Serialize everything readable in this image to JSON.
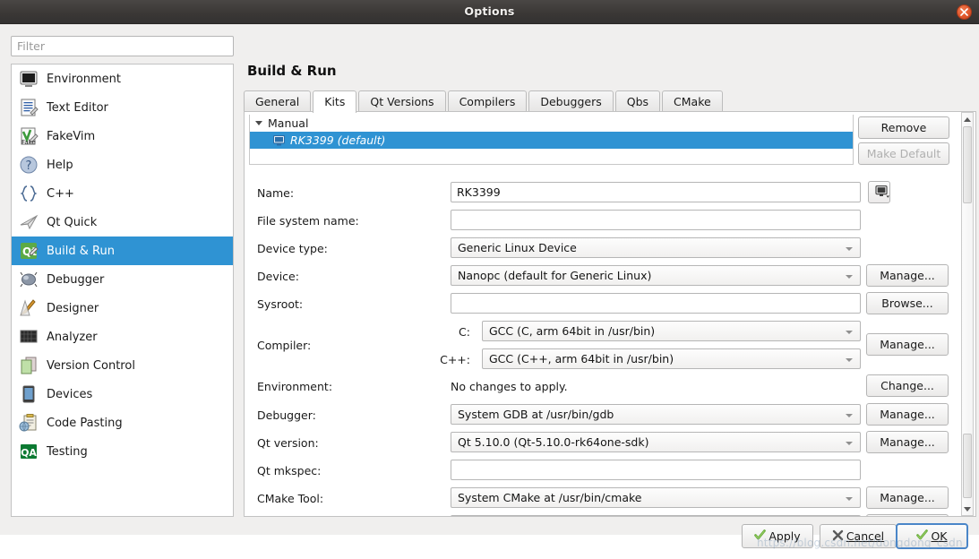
{
  "window": {
    "title": "Options",
    "close_icon": "close-icon"
  },
  "sidebar": {
    "filter_placeholder": "Filter",
    "filter_value": "",
    "items": [
      {
        "label": "Environment",
        "icon": "environment-icon",
        "selected": false
      },
      {
        "label": "Text Editor",
        "icon": "text-editor-icon",
        "selected": false
      },
      {
        "label": "FakeVim",
        "icon": "fakevim-icon",
        "selected": false
      },
      {
        "label": "Help",
        "icon": "help-icon",
        "selected": false
      },
      {
        "label": "C++",
        "icon": "cpp-icon",
        "selected": false
      },
      {
        "label": "Qt Quick",
        "icon": "qt-quick-icon",
        "selected": false
      },
      {
        "label": "Build & Run",
        "icon": "build-and-run-icon",
        "selected": true
      },
      {
        "label": "Debugger",
        "icon": "debugger-icon",
        "selected": false
      },
      {
        "label": "Designer",
        "icon": "designer-icon",
        "selected": false
      },
      {
        "label": "Analyzer",
        "icon": "analyzer-icon",
        "selected": false
      },
      {
        "label": "Version Control",
        "icon": "version-control-icon",
        "selected": false
      },
      {
        "label": "Devices",
        "icon": "devices-icon",
        "selected": false
      },
      {
        "label": "Code Pasting",
        "icon": "code-pasting-icon",
        "selected": false
      },
      {
        "label": "Testing",
        "icon": "testing-icon",
        "selected": false
      }
    ]
  },
  "page": {
    "title": "Build & Run",
    "tabs": [
      {
        "label": "General",
        "active": false
      },
      {
        "label": "Kits",
        "active": true
      },
      {
        "label": "Qt Versions",
        "active": false
      },
      {
        "label": "Compilers",
        "active": false
      },
      {
        "label": "Debuggers",
        "active": false
      },
      {
        "label": "Qbs",
        "active": false
      },
      {
        "label": "CMake",
        "active": false
      }
    ]
  },
  "kit_tree": {
    "group_label": "Manual",
    "expand_icon": "chevron-down-icon",
    "items": [
      {
        "label": "RK3399 (default)",
        "icon": "monitor-icon",
        "selected": true
      }
    ]
  },
  "kit_buttons": {
    "remove": "Remove",
    "make_default": "Make Default",
    "make_default_disabled": true
  },
  "form": {
    "name": {
      "label": "Name:",
      "value": "RK3399",
      "placeholder": "",
      "device_button_icon": "monitor-dropdown-icon"
    },
    "file_system_name": {
      "label": "File system name:",
      "value": "",
      "placeholder": ""
    },
    "device_type": {
      "label": "Device type:",
      "value": "Generic Linux Device"
    },
    "device": {
      "label": "Device:",
      "value": "Nanopc (default for Generic Linux)",
      "button": "Manage..."
    },
    "sysroot": {
      "label": "Sysroot:",
      "value": "",
      "placeholder": "",
      "button": "Browse..."
    },
    "compiler": {
      "label": "Compiler:",
      "c_label": "C:",
      "c_value": "GCC (C, arm 64bit in /usr/bin)",
      "cpp_label": "C++:",
      "cpp_value": "GCC (C++, arm 64bit in /usr/bin)",
      "button": "Manage..."
    },
    "environment": {
      "label": "Environment:",
      "value": "No changes to apply.",
      "button": "Change..."
    },
    "debugger": {
      "label": "Debugger:",
      "value": "System GDB at /usr/bin/gdb",
      "button": "Manage..."
    },
    "qt_version": {
      "label": "Qt version:",
      "value": "Qt 5.10.0 (Qt-5.10.0-rk64one-sdk)",
      "button": "Manage..."
    },
    "qt_mkspec": {
      "label": "Qt mkspec:",
      "value": "",
      "placeholder": ""
    },
    "cmake_tool": {
      "label": "CMake Tool:",
      "value": "System CMake at /usr/bin/cmake",
      "button": "Manage..."
    }
  },
  "footer": {
    "apply": "Apply",
    "cancel": "Cancel",
    "ok": "OK",
    "watermark": "https://blog.csdn.net/dongdong_csdn"
  }
}
